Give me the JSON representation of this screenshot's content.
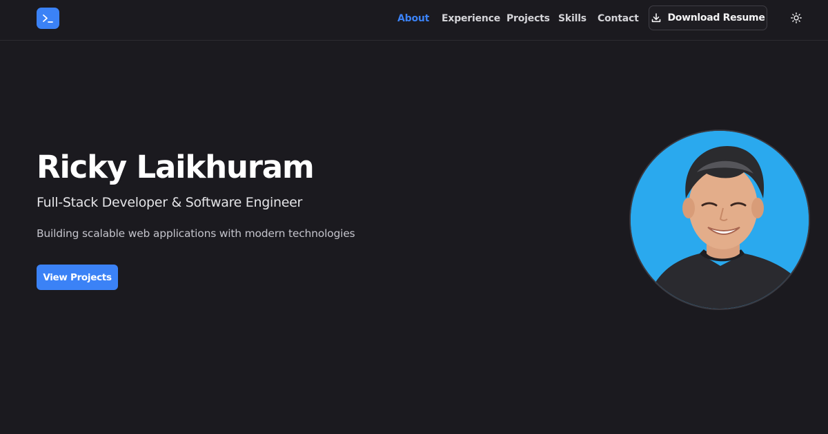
{
  "header": {
    "logo_icon": "terminal-icon",
    "nav": [
      {
        "label": "About",
        "active": true
      },
      {
        "label": "Experience",
        "active": false
      },
      {
        "label": "Projects",
        "active": false
      },
      {
        "label": "Skills",
        "active": false
      },
      {
        "label": "Contact",
        "active": false
      }
    ],
    "resume_button": {
      "label": "Download Resume",
      "icon": "download-icon"
    },
    "theme_toggle_icon": "sun-icon"
  },
  "hero": {
    "name": "Ricky Laikhuram",
    "role": "Full-Stack Developer & Software Engineer",
    "tagline": "Building scalable web applications with modern technologies",
    "cta_label": "View Projects",
    "avatar_icon": "profile-photo"
  },
  "colors": {
    "background": "#1b1a1f",
    "accent": "#3b82f6",
    "avatar_bg": "#2aa9ee"
  }
}
